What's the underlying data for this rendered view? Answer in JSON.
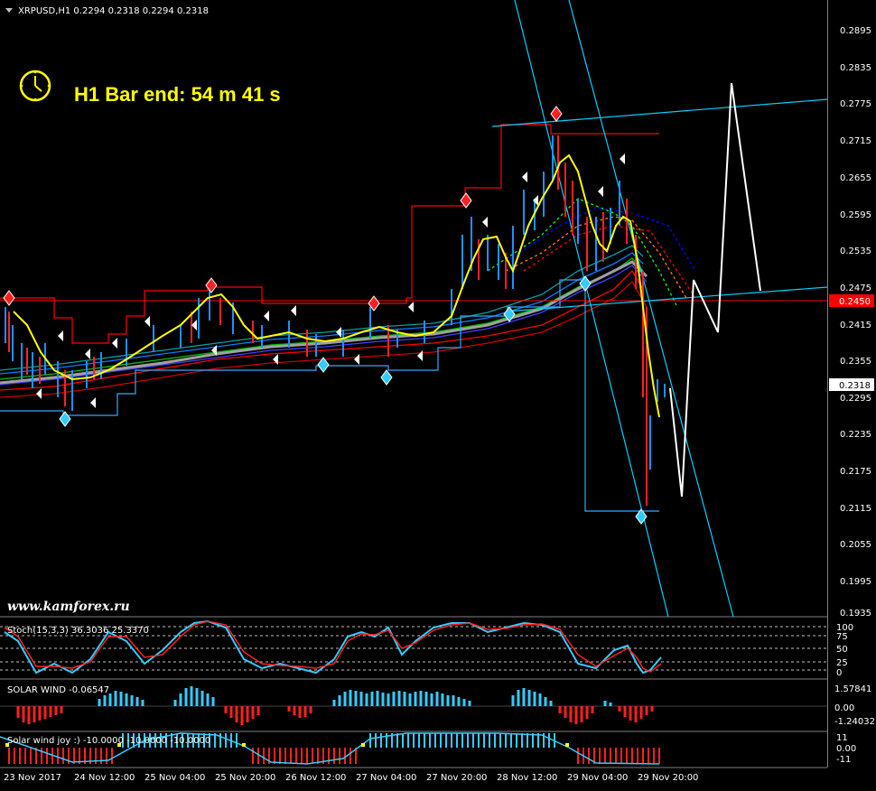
{
  "header": {
    "symbol_info": "XRPUSD,H1  0.2294 0.2318 0.2294 0.2318"
  },
  "timer": {
    "label": "H1 Bar end: 54 m 41 s"
  },
  "watermark": "www.kamforex.ru",
  "main_axis": {
    "ticks": [
      "0.2895",
      "0.2835",
      "0.2775",
      "0.2715",
      "0.2655",
      "0.2595",
      "0.2535",
      "0.2475",
      "0.2415",
      "0.2355",
      "0.2295",
      "0.2235",
      "0.2175",
      "0.2115",
      "0.2055",
      "0.1995",
      "0.1935"
    ],
    "ask_label": "0.2450",
    "bid_label": "0.2318",
    "colors": {
      "ask": "#ff0000",
      "bid": "#c0c0c0"
    }
  },
  "stoch": {
    "title": "Stoch(15,3,3) 36.3036 25.3370",
    "ticks": [
      "100",
      "75",
      "50",
      "25",
      "0"
    ]
  },
  "solar": {
    "title": "SOLAR WIND -0.06547",
    "ticks": [
      "1.57841",
      "0.00",
      "-1.24032"
    ]
  },
  "solar_joy": {
    "title": "Solar wind joy :) -10.0000 -10.0000 -10.0000",
    "ticks": [
      "11",
      "0.00",
      "-11"
    ]
  },
  "time_axis": {
    "labels": [
      "23 Nov 2017",
      "24 Nov 12:00",
      "25 Nov 04:00",
      "25 Nov 20:00",
      "26 Nov 12:00",
      "27 Nov 04:00",
      "27 Nov 20:00",
      "28 Nov 12:00",
      "29 Nov 04:00",
      "29 Nov 20:00"
    ]
  },
  "icons": {
    "menu": "triangle-down-icon",
    "clock": "clock-icon"
  }
}
